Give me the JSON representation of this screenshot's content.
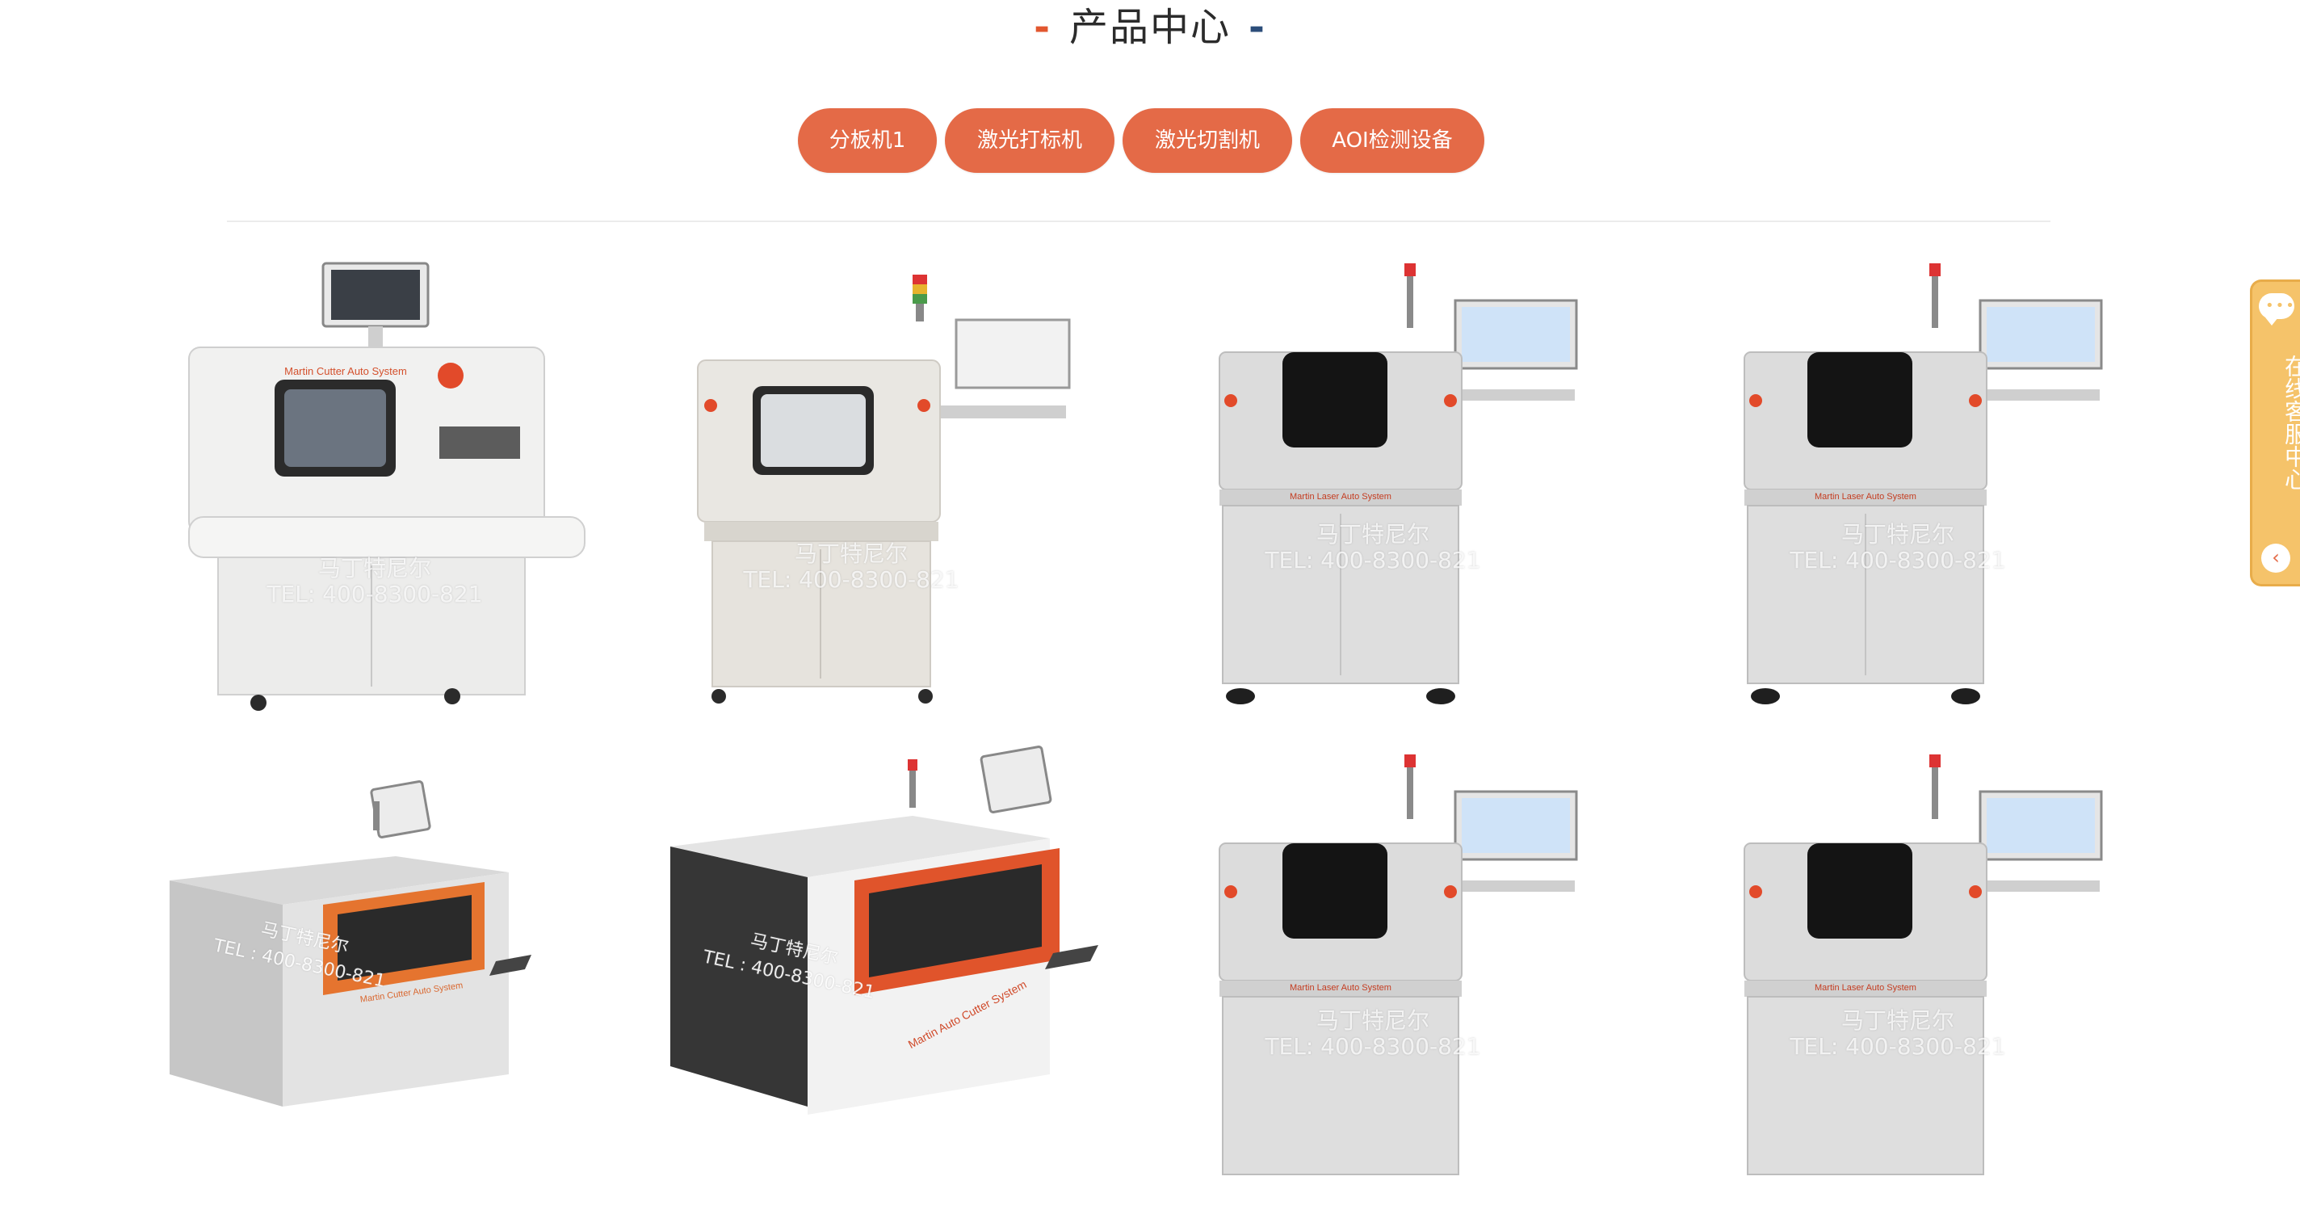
{
  "header": {
    "title": "产品中心"
  },
  "tabs": [
    {
      "label": "分板机1"
    },
    {
      "label": "激光打标机"
    },
    {
      "label": "激光切割机"
    },
    {
      "label": "AOI检测设备"
    }
  ],
  "products": [
    {
      "watermark_line1": "马丁特尼尔",
      "watermark_line2": "TEL: 400-8300-821",
      "brand": "Martin Cutter Auto System"
    },
    {
      "watermark_line1": "马丁特尼尔",
      "watermark_line2": "TEL: 400-8300-821"
    },
    {
      "watermark_line1": "马丁特尼尔",
      "watermark_line2": "TEL: 400-8300-821",
      "brand": "Martin Laser Auto System"
    },
    {
      "watermark_line1": "马丁特尼尔",
      "watermark_line2": "TEL: 400-8300-821",
      "brand": "Martin Laser Auto System"
    },
    {
      "watermark_line1": "马丁特尼尔",
      "watermark_line2": "TEL : 400-8300-821",
      "brand": "Martin Cutter Auto System"
    },
    {
      "watermark_line1": "马丁特尼尔",
      "watermark_line2": "TEL : 400-8300-821",
      "brand": "Martin Auto Cutter System"
    },
    {
      "watermark_line1": "马丁特尼尔",
      "watermark_line2": "TEL: 400-8300-821",
      "brand": "Martin Laser Auto System"
    },
    {
      "watermark_line1": "马丁特尼尔",
      "watermark_line2": "TEL: 400-8300-821",
      "brand": "Martin Laser Auto System"
    }
  ],
  "float_service": {
    "label": "在线客服中心"
  },
  "colors": {
    "accent": "#e46a47",
    "float_bg": "#f5c36a"
  }
}
